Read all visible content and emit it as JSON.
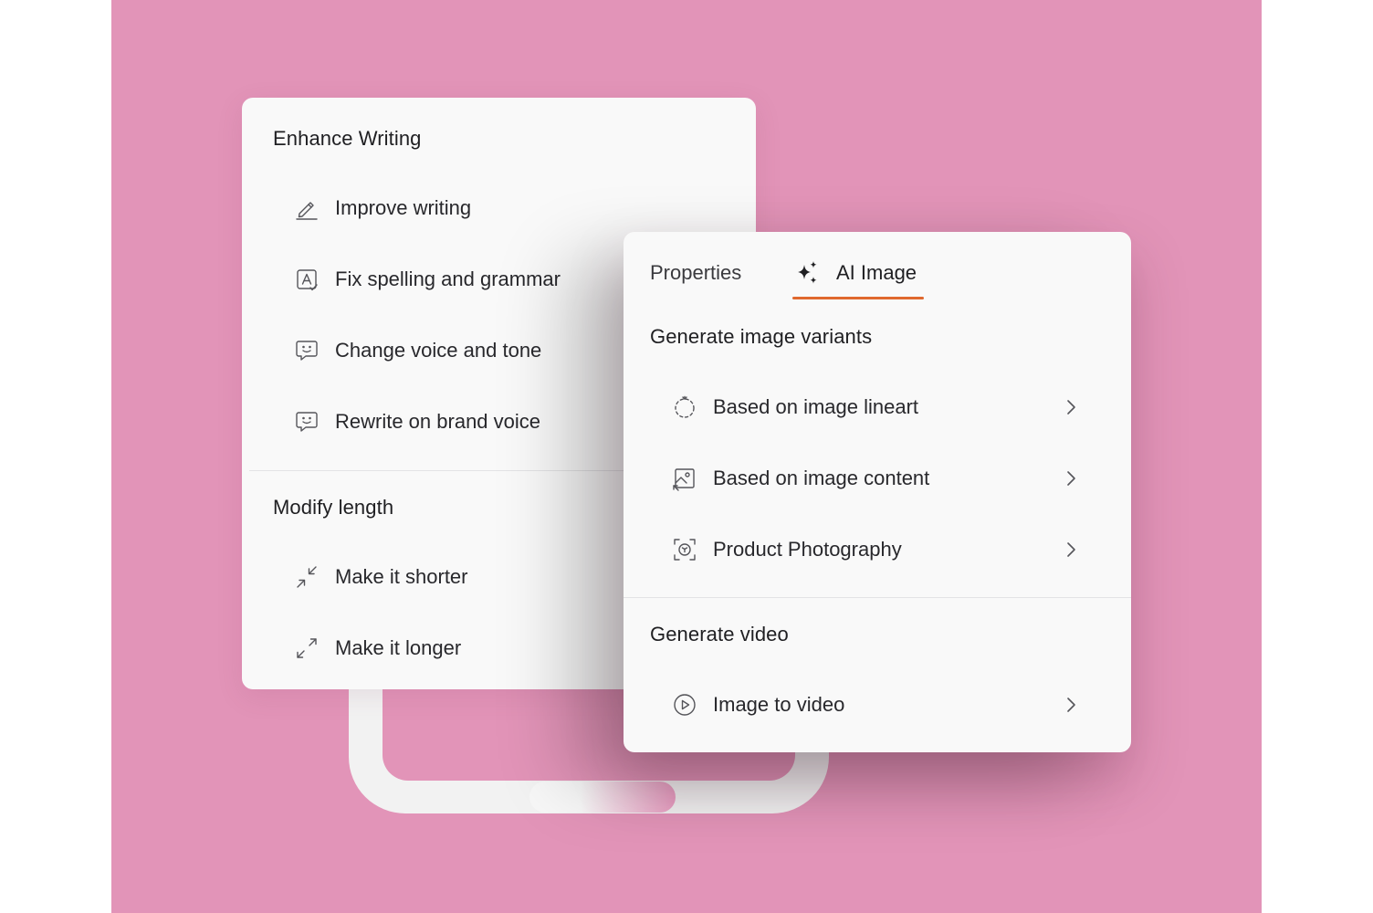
{
  "enhance_panel": {
    "section_enhance": "Enhance Writing",
    "items": [
      {
        "label": "Improve writing",
        "icon": "pencil-icon"
      },
      {
        "label": "Fix spelling and grammar",
        "icon": "spellcheck-icon"
      },
      {
        "label": "Change voice and tone",
        "icon": "speech-bubble-smile-icon"
      },
      {
        "label": "Rewrite on brand voice",
        "icon": "speech-bubble-smile-icon"
      }
    ],
    "section_length": "Modify length",
    "length_items": [
      {
        "label": "Make it shorter",
        "icon": "collapse-arrows-icon"
      },
      {
        "label": "Make it longer",
        "icon": "expand-arrows-icon"
      }
    ]
  },
  "ai_panel": {
    "tabs": [
      {
        "label": "Properties"
      },
      {
        "label": "AI Image",
        "icon": "sparkle-icon",
        "active": true
      }
    ],
    "section_variants": "Generate image variants",
    "variant_items": [
      {
        "label": "Based on image lineart",
        "icon": "dashed-circle-icon"
      },
      {
        "label": "Based on image content",
        "icon": "image-frame-icon"
      },
      {
        "label": "Product Photography",
        "icon": "product-focus-icon"
      }
    ],
    "section_video": "Generate video",
    "video_items": [
      {
        "label": "Image to video",
        "icon": "play-circle-icon"
      }
    ]
  },
  "colors": {
    "background": "#e294b8",
    "panel": "#f9f9f9",
    "accent": "#e0682e"
  }
}
